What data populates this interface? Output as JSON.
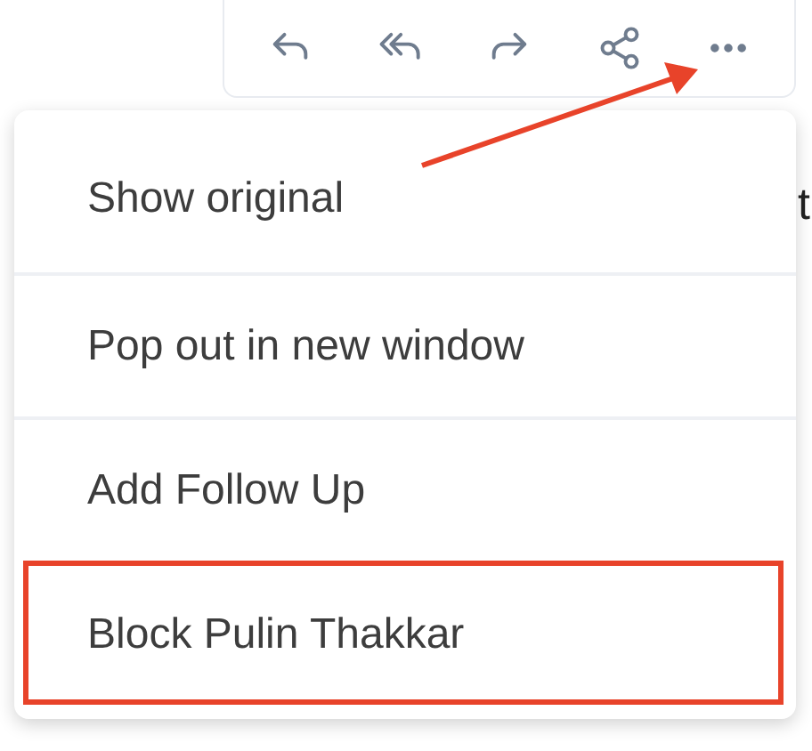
{
  "toolbar": {
    "buttons": [
      {
        "kind": "reply"
      },
      {
        "kind": "reply_all"
      },
      {
        "kind": "forward"
      },
      {
        "kind": "share"
      },
      {
        "kind": "more"
      }
    ]
  },
  "background_text": "t",
  "menu": {
    "items": [
      {
        "label": "Show original",
        "highlighted": false
      },
      {
        "label": "Pop out in new window",
        "highlighted": false
      },
      {
        "label": "Add Follow Up",
        "highlighted": false
      },
      {
        "label": "Block Pulin Thakkar",
        "highlighted": true
      }
    ]
  },
  "annotation": {
    "kind": "arrow"
  }
}
